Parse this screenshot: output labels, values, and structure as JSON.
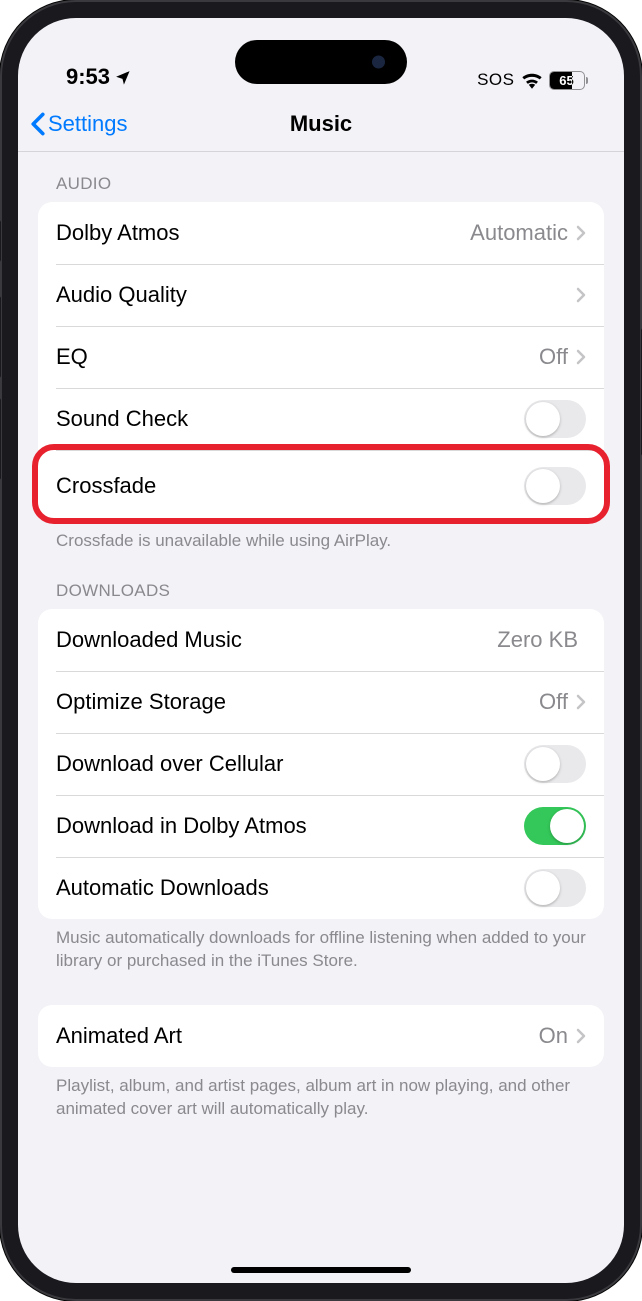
{
  "status": {
    "time": "9:53",
    "sos": "SOS",
    "battery_pct": "65"
  },
  "nav": {
    "back_label": "Settings",
    "title": "Music"
  },
  "sections": {
    "audio": {
      "header": "AUDIO",
      "dolby_atmos": {
        "label": "Dolby Atmos",
        "value": "Automatic"
      },
      "audio_quality": {
        "label": "Audio Quality"
      },
      "eq": {
        "label": "EQ",
        "value": "Off"
      },
      "sound_check": {
        "label": "Sound Check",
        "on": false
      },
      "crossfade": {
        "label": "Crossfade",
        "on": false
      },
      "footer": "Crossfade is unavailable while using AirPlay."
    },
    "downloads": {
      "header": "DOWNLOADS",
      "downloaded_music": {
        "label": "Downloaded Music",
        "value": "Zero KB"
      },
      "optimize_storage": {
        "label": "Optimize Storage",
        "value": "Off"
      },
      "download_cellular": {
        "label": "Download over Cellular",
        "on": false
      },
      "download_dolby": {
        "label": "Download in Dolby Atmos",
        "on": true
      },
      "automatic_downloads": {
        "label": "Automatic Downloads",
        "on": false
      },
      "footer": "Music automatically downloads for offline listening when added to your library or purchased in the iTunes Store."
    },
    "animated_art": {
      "label": "Animated Art",
      "value": "On",
      "footer": "Playlist, album, and artist pages, album art in now playing, and other animated cover art will automatically play."
    }
  }
}
